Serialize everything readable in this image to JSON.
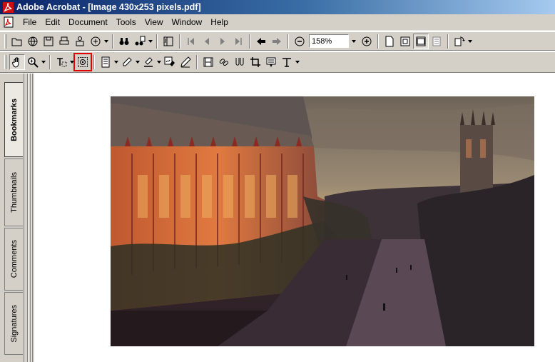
{
  "window": {
    "title": "Adobe Acrobat - [Image 430x253 pixels.pdf]"
  },
  "menu": {
    "items": [
      "File",
      "Edit",
      "Document",
      "Tools",
      "View",
      "Window",
      "Help"
    ]
  },
  "toolbar": {
    "zoom_value": "158%"
  },
  "side_tabs": [
    {
      "label": "Bookmarks",
      "active": true
    },
    {
      "label": "Thumbnails",
      "active": false
    },
    {
      "label": "Comments",
      "active": false
    },
    {
      "label": "Signatures",
      "active": false
    }
  ],
  "document": {
    "image_icon": "photo-campus-dusk"
  },
  "colors": {
    "titlebar_start": "#0a246a",
    "chrome": "#d4d0c8",
    "highlight_box": "#e00000"
  }
}
